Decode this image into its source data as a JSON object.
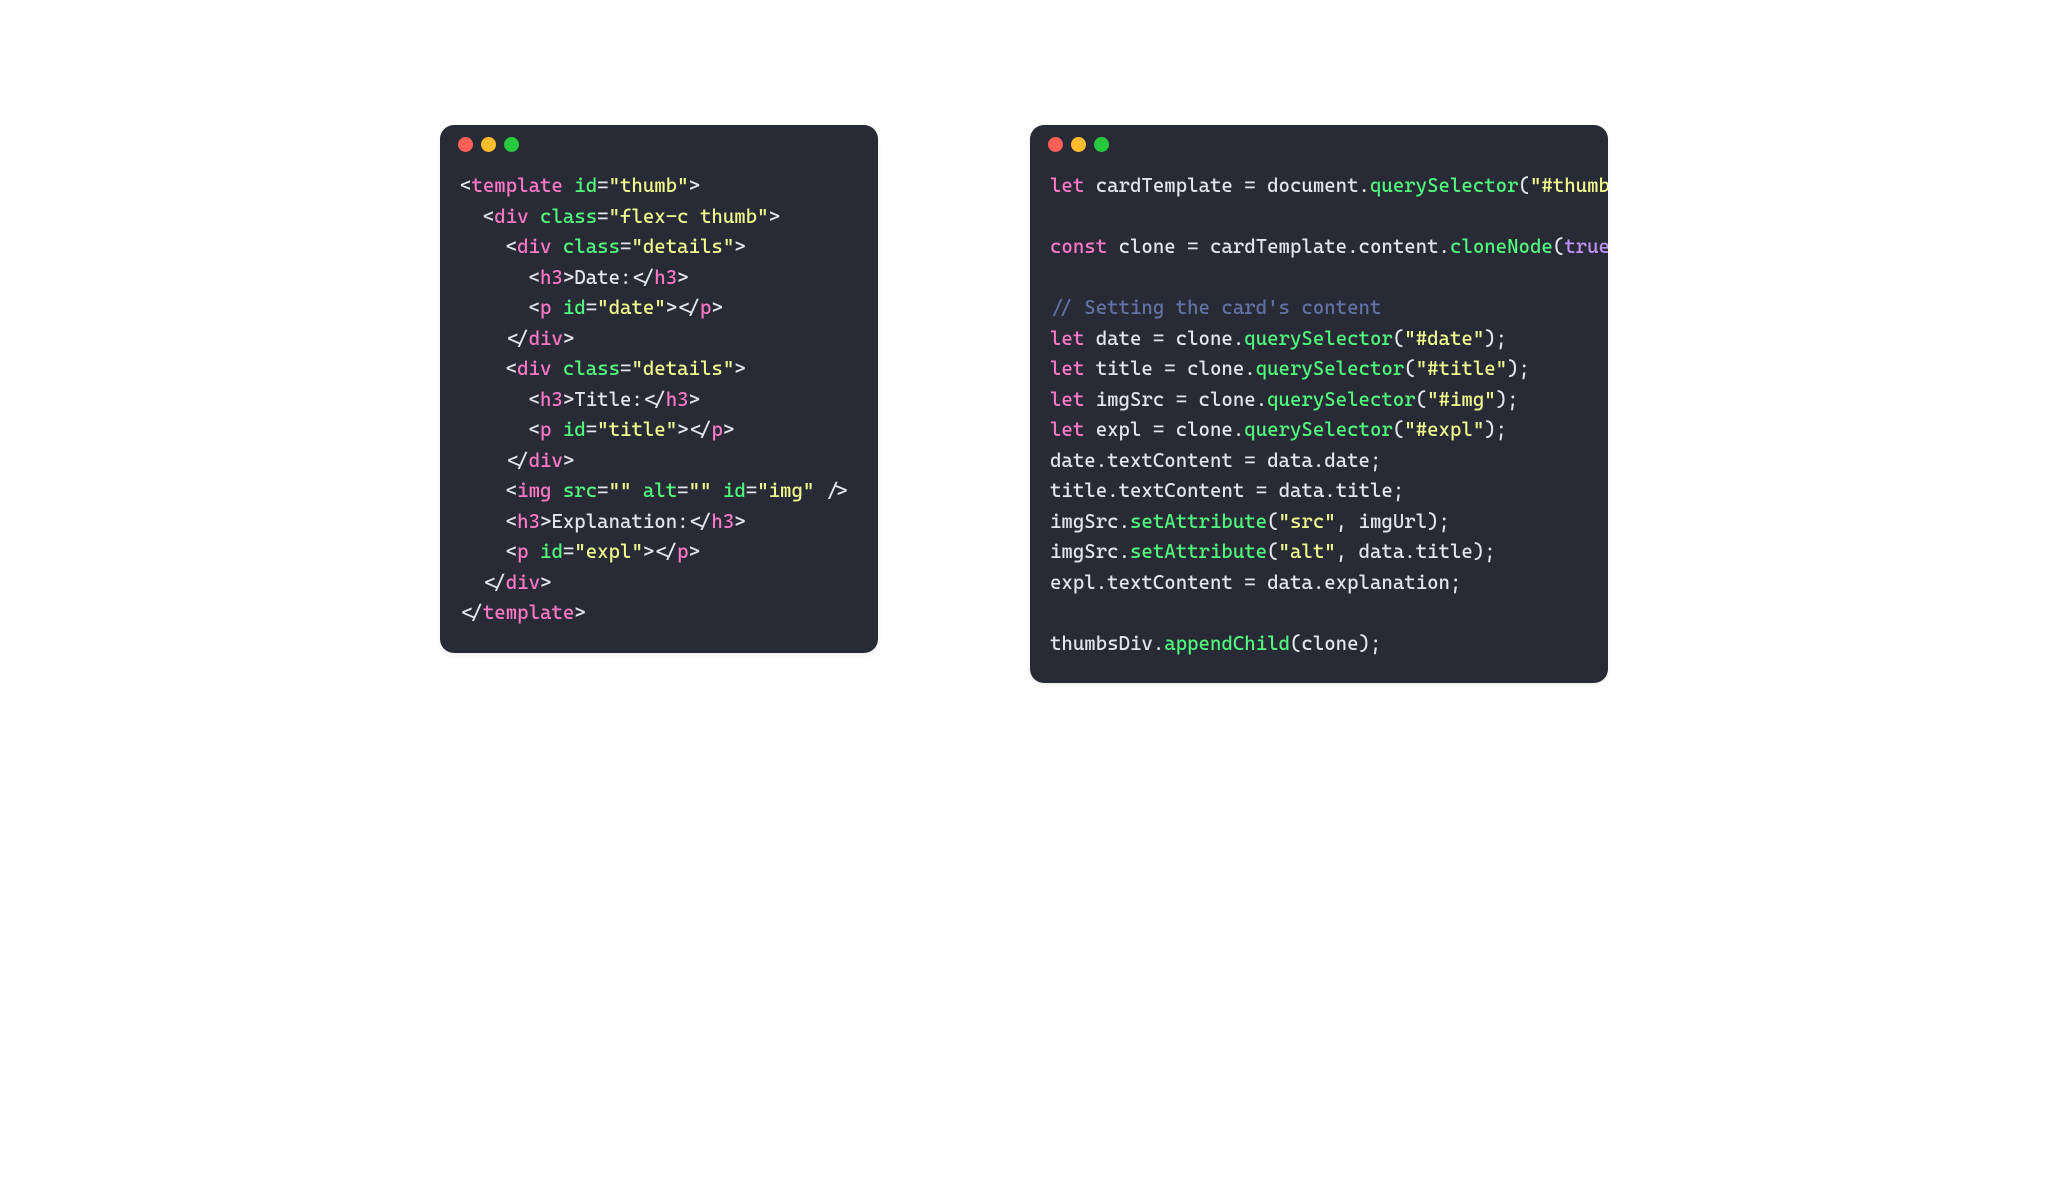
{
  "windows": [
    {
      "side": "left",
      "language": "html",
      "tokens": [
        [
          [
            "<",
            "punc"
          ],
          [
            "template",
            "tag"
          ],
          [
            " ",
            "punc"
          ],
          [
            "id",
            "attr"
          ],
          [
            "=",
            "punc"
          ],
          [
            "\"thumb\"",
            "str"
          ],
          [
            ">",
            "punc"
          ]
        ],
        [
          [
            "  ",
            "punc"
          ],
          [
            "<",
            "punc"
          ],
          [
            "div",
            "tag"
          ],
          [
            " ",
            "punc"
          ],
          [
            "class",
            "attr"
          ],
          [
            "=",
            "punc"
          ],
          [
            "\"flex-c thumb\"",
            "str"
          ],
          [
            ">",
            "punc"
          ]
        ],
        [
          [
            "    ",
            "punc"
          ],
          [
            "<",
            "punc"
          ],
          [
            "div",
            "tag"
          ],
          [
            " ",
            "punc"
          ],
          [
            "class",
            "attr"
          ],
          [
            "=",
            "punc"
          ],
          [
            "\"details\"",
            "str"
          ],
          [
            ">",
            "punc"
          ]
        ],
        [
          [
            "      ",
            "punc"
          ],
          [
            "<",
            "punc"
          ],
          [
            "h3",
            "tag"
          ],
          [
            ">",
            "punc"
          ],
          [
            "Date:",
            "text"
          ],
          [
            "</",
            "punc"
          ],
          [
            "h3",
            "tag"
          ],
          [
            ">",
            "punc"
          ]
        ],
        [
          [
            "      ",
            "punc"
          ],
          [
            "<",
            "punc"
          ],
          [
            "p",
            "tag"
          ],
          [
            " ",
            "punc"
          ],
          [
            "id",
            "attr"
          ],
          [
            "=",
            "punc"
          ],
          [
            "\"date\"",
            "str"
          ],
          [
            "></",
            "punc"
          ],
          [
            "p",
            "tag"
          ],
          [
            ">",
            "punc"
          ]
        ],
        [
          [
            "    ",
            "punc"
          ],
          [
            "</",
            "punc"
          ],
          [
            "div",
            "tag"
          ],
          [
            ">",
            "punc"
          ]
        ],
        [
          [
            "    ",
            "punc"
          ],
          [
            "<",
            "punc"
          ],
          [
            "div",
            "tag"
          ],
          [
            " ",
            "punc"
          ],
          [
            "class",
            "attr"
          ],
          [
            "=",
            "punc"
          ],
          [
            "\"details\"",
            "str"
          ],
          [
            ">",
            "punc"
          ]
        ],
        [
          [
            "      ",
            "punc"
          ],
          [
            "<",
            "punc"
          ],
          [
            "h3",
            "tag"
          ],
          [
            ">",
            "punc"
          ],
          [
            "Title:",
            "text"
          ],
          [
            "</",
            "punc"
          ],
          [
            "h3",
            "tag"
          ],
          [
            ">",
            "punc"
          ]
        ],
        [
          [
            "      ",
            "punc"
          ],
          [
            "<",
            "punc"
          ],
          [
            "p",
            "tag"
          ],
          [
            " ",
            "punc"
          ],
          [
            "id",
            "attr"
          ],
          [
            "=",
            "punc"
          ],
          [
            "\"title\"",
            "str"
          ],
          [
            "></",
            "punc"
          ],
          [
            "p",
            "tag"
          ],
          [
            ">",
            "punc"
          ]
        ],
        [
          [
            "    ",
            "punc"
          ],
          [
            "</",
            "punc"
          ],
          [
            "div",
            "tag"
          ],
          [
            ">",
            "punc"
          ]
        ],
        [
          [
            "    ",
            "punc"
          ],
          [
            "<",
            "punc"
          ],
          [
            "img",
            "tag"
          ],
          [
            " ",
            "punc"
          ],
          [
            "src",
            "attr"
          ],
          [
            "=",
            "punc"
          ],
          [
            "\"\"",
            "str"
          ],
          [
            " ",
            "punc"
          ],
          [
            "alt",
            "attr"
          ],
          [
            "=",
            "punc"
          ],
          [
            "\"\"",
            "str"
          ],
          [
            " ",
            "punc"
          ],
          [
            "id",
            "attr"
          ],
          [
            "=",
            "punc"
          ],
          [
            "\"img\"",
            "str"
          ],
          [
            " />",
            "punc"
          ]
        ],
        [
          [
            "    ",
            "punc"
          ],
          [
            "<",
            "punc"
          ],
          [
            "h3",
            "tag"
          ],
          [
            ">",
            "punc"
          ],
          [
            "Explanation:",
            "text"
          ],
          [
            "</",
            "punc"
          ],
          [
            "h3",
            "tag"
          ],
          [
            ">",
            "punc"
          ]
        ],
        [
          [
            "    ",
            "punc"
          ],
          [
            "<",
            "punc"
          ],
          [
            "p",
            "tag"
          ],
          [
            " ",
            "punc"
          ],
          [
            "id",
            "attr"
          ],
          [
            "=",
            "punc"
          ],
          [
            "\"expl\"",
            "str"
          ],
          [
            "></",
            "punc"
          ],
          [
            "p",
            "tag"
          ],
          [
            ">",
            "punc"
          ]
        ],
        [
          [
            "  ",
            "punc"
          ],
          [
            "</",
            "punc"
          ],
          [
            "div",
            "tag"
          ],
          [
            ">",
            "punc"
          ]
        ],
        [
          [
            "</",
            "punc"
          ],
          [
            "template",
            "tag"
          ],
          [
            ">",
            "punc"
          ]
        ]
      ]
    },
    {
      "side": "right",
      "language": "javascript",
      "tokens": [
        [
          [
            "let",
            "tag"
          ],
          [
            " cardTemplate ",
            "var"
          ],
          [
            "=",
            "punc"
          ],
          [
            " document",
            "var"
          ],
          [
            ".",
            "punc"
          ],
          [
            "querySelector",
            "attr"
          ],
          [
            "(",
            "punc"
          ],
          [
            "\"#thumb\"",
            "str"
          ],
          [
            ");",
            "punc"
          ]
        ],
        [],
        [
          [
            "const",
            "tag"
          ],
          [
            " clone ",
            "var"
          ],
          [
            "=",
            "punc"
          ],
          [
            " cardTemplate",
            "var"
          ],
          [
            ".",
            "punc"
          ],
          [
            "content",
            "var"
          ],
          [
            ".",
            "punc"
          ],
          [
            "cloneNode",
            "attr"
          ],
          [
            "(",
            "punc"
          ],
          [
            "true",
            "bool"
          ],
          [
            ");",
            "punc"
          ]
        ],
        [],
        [
          [
            "// Setting the card's content",
            "comment"
          ]
        ],
        [
          [
            "let",
            "tag"
          ],
          [
            " date ",
            "var"
          ],
          [
            "=",
            "punc"
          ],
          [
            " clone",
            "var"
          ],
          [
            ".",
            "punc"
          ],
          [
            "querySelector",
            "attr"
          ],
          [
            "(",
            "punc"
          ],
          [
            "\"#date\"",
            "str"
          ],
          [
            ");",
            "punc"
          ]
        ],
        [
          [
            "let",
            "tag"
          ],
          [
            " title ",
            "var"
          ],
          [
            "=",
            "punc"
          ],
          [
            " clone",
            "var"
          ],
          [
            ".",
            "punc"
          ],
          [
            "querySelector",
            "attr"
          ],
          [
            "(",
            "punc"
          ],
          [
            "\"#title\"",
            "str"
          ],
          [
            ");",
            "punc"
          ]
        ],
        [
          [
            "let",
            "tag"
          ],
          [
            " imgSrc ",
            "var"
          ],
          [
            "=",
            "punc"
          ],
          [
            " clone",
            "var"
          ],
          [
            ".",
            "punc"
          ],
          [
            "querySelector",
            "attr"
          ],
          [
            "(",
            "punc"
          ],
          [
            "\"#img\"",
            "str"
          ],
          [
            ");",
            "punc"
          ]
        ],
        [
          [
            "let",
            "tag"
          ],
          [
            " expl ",
            "var"
          ],
          [
            "=",
            "punc"
          ],
          [
            " clone",
            "var"
          ],
          [
            ".",
            "punc"
          ],
          [
            "querySelector",
            "attr"
          ],
          [
            "(",
            "punc"
          ],
          [
            "\"#expl\"",
            "str"
          ],
          [
            ");",
            "punc"
          ]
        ],
        [
          [
            "date",
            "var"
          ],
          [
            ".",
            "punc"
          ],
          [
            "textContent",
            "var"
          ],
          [
            " ",
            "punc"
          ],
          [
            "=",
            "punc"
          ],
          [
            " data",
            "var"
          ],
          [
            ".",
            "punc"
          ],
          [
            "date",
            "var"
          ],
          [
            ";",
            "punc"
          ]
        ],
        [
          [
            "title",
            "var"
          ],
          [
            ".",
            "punc"
          ],
          [
            "textContent",
            "var"
          ],
          [
            " ",
            "punc"
          ],
          [
            "=",
            "punc"
          ],
          [
            " data",
            "var"
          ],
          [
            ".",
            "punc"
          ],
          [
            "title",
            "var"
          ],
          [
            ";",
            "punc"
          ]
        ],
        [
          [
            "imgSrc",
            "var"
          ],
          [
            ".",
            "punc"
          ],
          [
            "setAttribute",
            "attr"
          ],
          [
            "(",
            "punc"
          ],
          [
            "\"src\"",
            "str"
          ],
          [
            ", imgUrl);",
            "punc"
          ]
        ],
        [
          [
            "imgSrc",
            "var"
          ],
          [
            ".",
            "punc"
          ],
          [
            "setAttribute",
            "attr"
          ],
          [
            "(",
            "punc"
          ],
          [
            "\"alt\"",
            "str"
          ],
          [
            ", data",
            "punc"
          ],
          [
            ".",
            "punc"
          ],
          [
            "title",
            "var"
          ],
          [
            ");",
            "punc"
          ]
        ],
        [
          [
            "expl",
            "var"
          ],
          [
            ".",
            "punc"
          ],
          [
            "textContent",
            "var"
          ],
          [
            " ",
            "punc"
          ],
          [
            "=",
            "punc"
          ],
          [
            " data",
            "var"
          ],
          [
            ".",
            "punc"
          ],
          [
            "explanation",
            "var"
          ],
          [
            ";",
            "punc"
          ]
        ],
        [],
        [
          [
            "thumbsDiv",
            "var"
          ],
          [
            ".",
            "punc"
          ],
          [
            "appendChild",
            "attr"
          ],
          [
            "(clone);",
            "punc"
          ]
        ]
      ]
    }
  ]
}
